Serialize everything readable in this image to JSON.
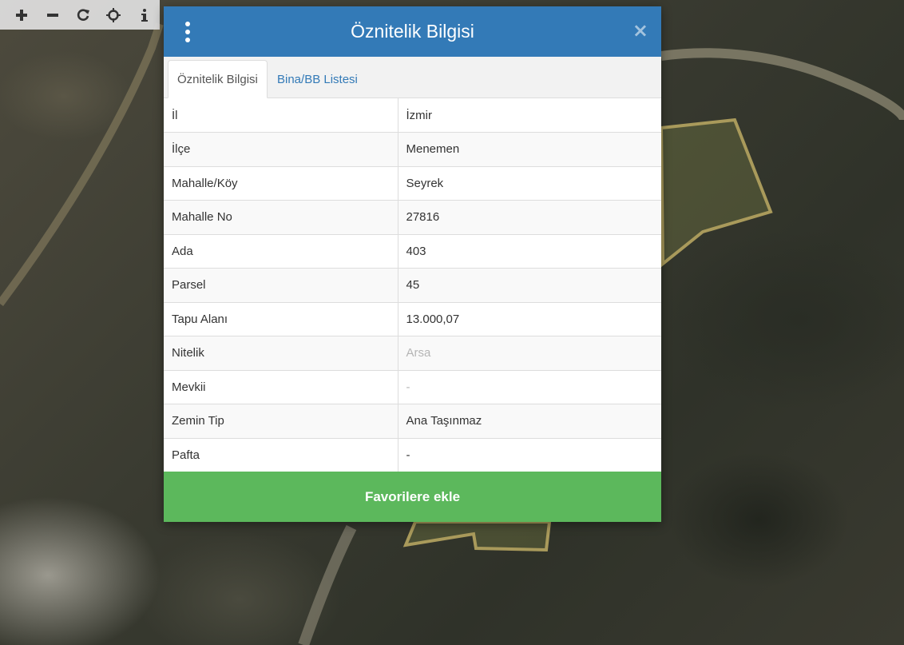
{
  "toolbar": {
    "buttons": [
      {
        "name": "zoom-in",
        "glyph": "+"
      },
      {
        "name": "zoom-out",
        "glyph": "−"
      },
      {
        "name": "refresh",
        "glyph": "⟳"
      },
      {
        "name": "locate",
        "glyph": "⌖"
      },
      {
        "name": "info",
        "glyph": "i"
      }
    ]
  },
  "modal": {
    "title": "Öznitelik Bilgisi",
    "close_glyph": "×",
    "header_color": "#337ab7",
    "tabs": [
      {
        "label": "Öznitelik Bilgisi",
        "active": true
      },
      {
        "label": "Bina/BB Listesi",
        "active": false
      }
    ],
    "rows": [
      {
        "key": "İl",
        "value": "İzmir"
      },
      {
        "key": "İlçe",
        "value": "Menemen"
      },
      {
        "key": "Mahalle/Köy",
        "value": "Seyrek"
      },
      {
        "key": "Mahalle No",
        "value": "27816"
      },
      {
        "key": "Ada",
        "value": "403"
      },
      {
        "key": "Parsel",
        "value": "45"
      },
      {
        "key": "Tapu Alanı",
        "value": "13.000,07"
      },
      {
        "key": "Nitelik",
        "value": "Arsa"
      },
      {
        "key": "Mevkii",
        "value": "-"
      },
      {
        "key": "Zemin Tip",
        "value": "Ana Taşınmaz"
      },
      {
        "key": "Pafta",
        "value": "-"
      }
    ],
    "favorite_button": "Favorilere ekle",
    "favorite_color": "#5cb85c"
  }
}
